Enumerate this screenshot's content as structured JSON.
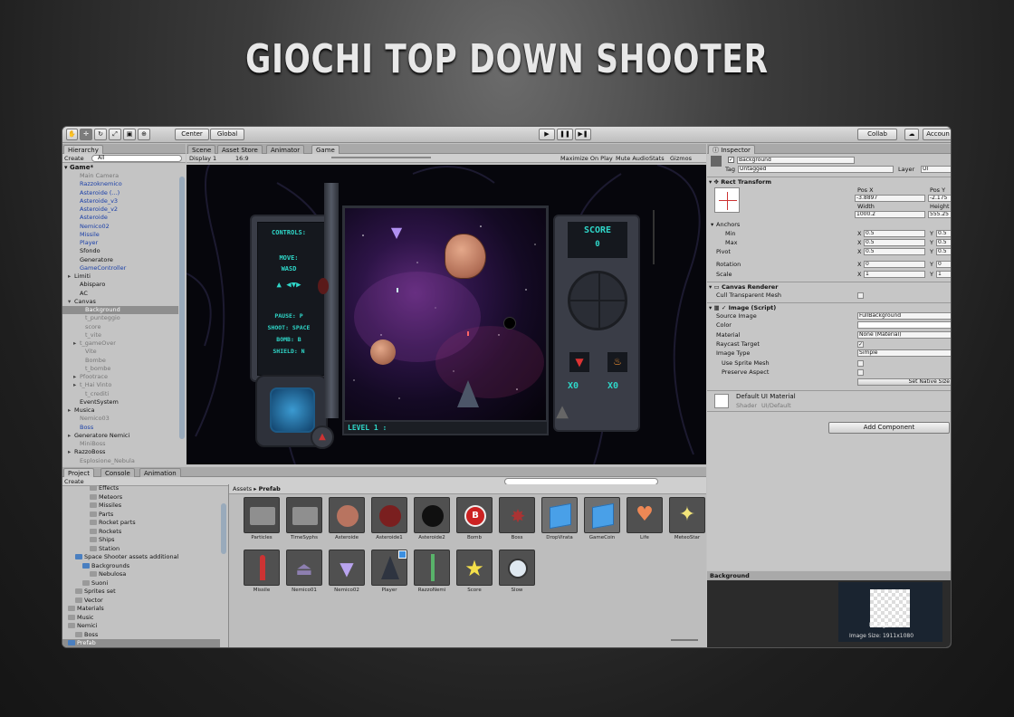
{
  "headline": "GIOCHI TOP DOWN SHOOTER",
  "toolbar": {
    "center": "Center",
    "global": "Global",
    "collab": "Collab",
    "account": "Accoun"
  },
  "hierarchy": {
    "tab": "Hierarchy",
    "create": "Create",
    "search": "All",
    "scene": "Game*",
    "items": [
      {
        "t": "Main Camera",
        "c": "gray",
        "ind": 2,
        "a": ""
      },
      {
        "t": "Razzoknemico",
        "c": "blue",
        "ind": 2,
        "a": ""
      },
      {
        "t": "Asteroide (...)",
        "c": "blue",
        "ind": 2,
        "a": ""
      },
      {
        "t": "Asteroide_v3",
        "c": "blue",
        "ind": 2,
        "a": ""
      },
      {
        "t": "Asteroide_v2",
        "c": "blue",
        "ind": 2,
        "a": ""
      },
      {
        "t": "Asteroide",
        "c": "blue",
        "ind": 2,
        "a": ""
      },
      {
        "t": "Nemico02",
        "c": "blue",
        "ind": 2,
        "a": ""
      },
      {
        "t": "Missile",
        "c": "blue",
        "ind": 2,
        "a": ""
      },
      {
        "t": "Player",
        "c": "blue",
        "ind": 2,
        "a": ""
      },
      {
        "t": "Sfondo",
        "c": "",
        "ind": 2,
        "a": ""
      },
      {
        "t": "Generatore",
        "c": "",
        "ind": 2,
        "a": ""
      },
      {
        "t": "GameController",
        "c": "blue",
        "ind": 2,
        "a": ""
      },
      {
        "t": "Limiti",
        "c": "",
        "ind": 1,
        "a": "▸"
      },
      {
        "t": "Abisparo",
        "c": "",
        "ind": 2,
        "a": ""
      },
      {
        "t": "AC",
        "c": "",
        "ind": 2,
        "a": ""
      },
      {
        "t": "Canvas",
        "c": "",
        "ind": 1,
        "a": "▾"
      },
      {
        "t": "Background",
        "c": "sel",
        "ind": 3,
        "a": ""
      },
      {
        "t": "t_punteggio",
        "c": "gray",
        "ind": 3,
        "a": ""
      },
      {
        "t": "score",
        "c": "gray",
        "ind": 3,
        "a": ""
      },
      {
        "t": "t_vite",
        "c": "gray",
        "ind": 3,
        "a": ""
      },
      {
        "t": "t_gameOver",
        "c": "gray",
        "ind": 2,
        "a": "▸"
      },
      {
        "t": "Vite",
        "c": "gray",
        "ind": 3,
        "a": ""
      },
      {
        "t": "Bombe",
        "c": "gray",
        "ind": 3,
        "a": ""
      },
      {
        "t": "t_bombe",
        "c": "gray",
        "ind": 3,
        "a": ""
      },
      {
        "t": "Pfootrace",
        "c": "gray",
        "ind": 2,
        "a": "▸"
      },
      {
        "t": "t_Hai Vinto",
        "c": "gray",
        "ind": 2,
        "a": "▸"
      },
      {
        "t": "t_crediti",
        "c": "gray",
        "ind": 3,
        "a": ""
      },
      {
        "t": "EventSystem",
        "c": "",
        "ind": 2,
        "a": ""
      },
      {
        "t": "Musica",
        "c": "",
        "ind": 1,
        "a": "▸"
      },
      {
        "t": "Nemico03",
        "c": "gray",
        "ind": 2,
        "a": ""
      },
      {
        "t": "Boss",
        "c": "blue",
        "ind": 2,
        "a": ""
      },
      {
        "t": "Generatore Nemici",
        "c": "",
        "ind": 1,
        "a": "▸"
      },
      {
        "t": "MiniBoss",
        "c": "gray",
        "ind": 2,
        "a": ""
      },
      {
        "t": "RazzoBoss",
        "c": "",
        "ind": 1,
        "a": "▸"
      },
      {
        "t": "Esplosione_Nebula",
        "c": "gray",
        "ind": 2,
        "a": ""
      }
    ]
  },
  "scene_tabs": [
    "Scene",
    "Asset Store",
    "Animator",
    "Game"
  ],
  "game_bar": {
    "display": "Display 1",
    "aspect": "16:9",
    "maximize": "Maximize On Play",
    "mute": "Mute Audio",
    "stats": "Stats",
    "gizmos": "Gizmos"
  },
  "game": {
    "controls_title": "CONTROLS:",
    "move_label": "MOVE:",
    "move_keys": "WASD",
    "arrows": "▲ ◀▼▶",
    "pause": "PAUSE: P",
    "shoot": "SHOOT: SPACE",
    "bomb": "BOMB: B",
    "shield": "SHIELD: N",
    "score_label": "SCORE",
    "score_value": "0",
    "lives": "X0",
    "bombs": "X0",
    "level": "LEVEL 1 :"
  },
  "inspector": {
    "tab": "Inspector",
    "name": "Background",
    "tag_label": "Tag",
    "tag": "Untagged",
    "layer_label": "Layer",
    "layer": "UI",
    "rect_title": "Rect Transform",
    "anchor_label": "center",
    "posx_label": "Pos X",
    "posy_label": "Pos Y",
    "posx": "-3.8897",
    "posy": "-2.175",
    "width_label": "Width",
    "height_label": "Height",
    "width": "1000.2",
    "height": "555.25",
    "anchors": "Anchors",
    "min": "Min",
    "max": "Max",
    "pivot": "Pivot",
    "rotation": "Rotation",
    "scale": "Scale",
    "min_x": "0.5",
    "min_y": "0.5",
    "max_x": "0.5",
    "max_y": "0.5",
    "pivot_x": "0.5",
    "pivot_y": "0.5",
    "rot_x": "0",
    "rot_y": "0",
    "scale_x": "1",
    "scale_y": "1",
    "canvas_renderer": "Canvas Renderer",
    "cull": "Cull Transparent Mesh",
    "image_script": "Image (Script)",
    "source_image_label": "Source Image",
    "source_image": "FullBackground",
    "color_label": "Color",
    "material_label": "Material",
    "material": "None (Material)",
    "raycast": "Raycast Target",
    "image_type_label": "Image Type",
    "image_type": "Simple",
    "sprite_mesh": "Use Sprite Mesh",
    "aspect": "Preserve Aspect",
    "set_native": "Set Native Size",
    "default_mat": "Default UI Material",
    "shader_label": "Shader",
    "shader": "UI/Default",
    "add_component": "Add Component",
    "preview_title": "Background",
    "preview_caption": "Background",
    "image_size": "Image Size: 1911x1080"
  },
  "project": {
    "tabs": [
      "Project",
      "Console",
      "Animation"
    ],
    "create": "Create",
    "tree": [
      {
        "t": "Effects",
        "ind": 3,
        "b": false
      },
      {
        "t": "Meteors",
        "ind": 3,
        "b": false
      },
      {
        "t": "Missiles",
        "ind": 3,
        "b": false
      },
      {
        "t": "Parts",
        "ind": 3,
        "b": false
      },
      {
        "t": "Rocket parts",
        "ind": 3,
        "b": false
      },
      {
        "t": "Rockets",
        "ind": 3,
        "b": false
      },
      {
        "t": "Ships",
        "ind": 3,
        "b": false
      },
      {
        "t": "Station",
        "ind": 3,
        "b": false
      },
      {
        "t": "Space Shooter assets additional",
        "ind": 1,
        "b": true
      },
      {
        "t": "Backgrounds",
        "ind": 2,
        "b": true
      },
      {
        "t": "Nebulosa",
        "ind": 3,
        "b": false
      },
      {
        "t": "Suoni",
        "ind": 2,
        "b": false
      },
      {
        "t": "Sprites set",
        "ind": 1,
        "b": false
      },
      {
        "t": "Vector",
        "ind": 1,
        "b": false
      },
      {
        "t": "Materials",
        "ind": 0,
        "b": false
      },
      {
        "t": "Music",
        "ind": 0,
        "b": false
      },
      {
        "t": "Nemici",
        "ind": 0,
        "b": false
      },
      {
        "t": "Boss",
        "ind": 1,
        "b": false
      },
      {
        "t": "Prefab",
        "ind": 0,
        "b": true,
        "sel": true
      }
    ],
    "breadcrumb": [
      "Assets",
      "Prefab"
    ],
    "assets_row1": [
      "Particles",
      "TimeSyphs",
      "Asteroide",
      "Asteroide1",
      "Asteroide2",
      "Bomb",
      "Boss",
      "DropVirata",
      "GameCoin",
      "Life",
      "MeteoStar"
    ],
    "assets_row2": [
      "Missile",
      "Nemico01",
      "Nemico02",
      "Player",
      "RazzoNemi",
      "Score",
      "Slow"
    ]
  }
}
